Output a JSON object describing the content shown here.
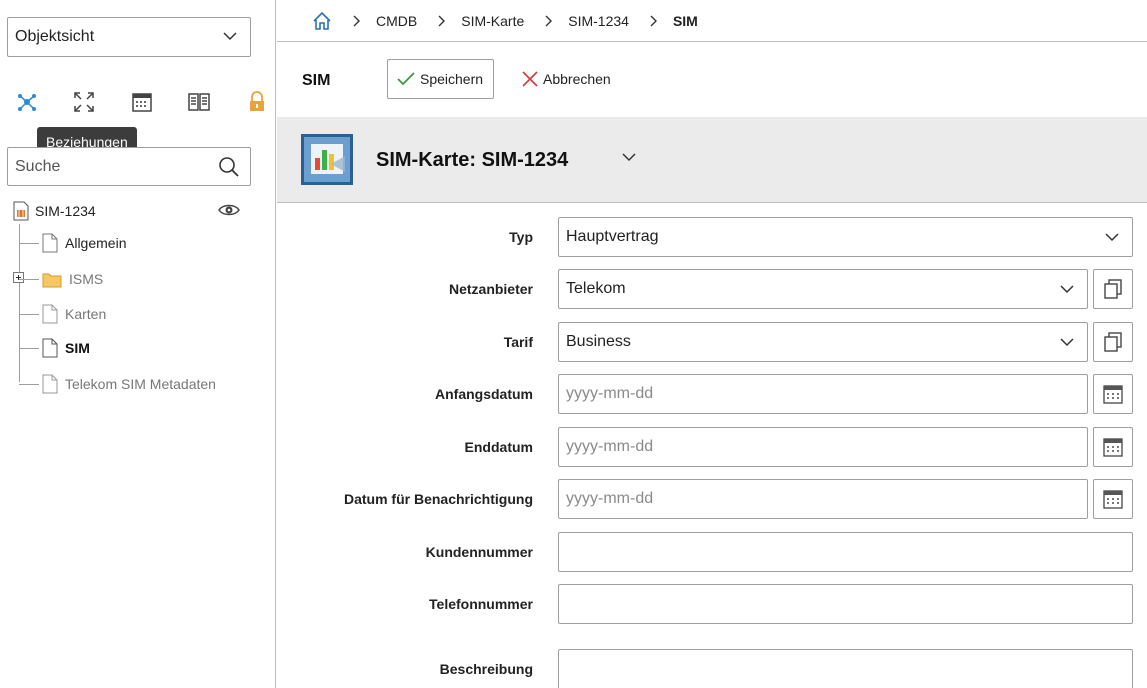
{
  "sidebar": {
    "view_select": "Objektsicht",
    "icons": [
      "relations-icon",
      "expand-icon",
      "calendar-icon",
      "book-icon",
      "lock-icon"
    ],
    "tooltip": "Beziehungen",
    "search_placeholder": "Suche",
    "tree": {
      "root": "SIM-1234",
      "items": [
        {
          "label": "Allgemein",
          "icon": "file-icon"
        },
        {
          "label": "ISMS",
          "icon": "folder-icon"
        },
        {
          "label": "Karten",
          "icon": "file-icon"
        },
        {
          "label": "SIM",
          "icon": "file-icon"
        },
        {
          "label": "Telekom SIM Metadaten",
          "icon": "file-icon"
        }
      ]
    }
  },
  "breadcrumb": {
    "items": [
      "CMDB",
      "SIM-Karte",
      "SIM-1234"
    ],
    "current": "SIM"
  },
  "toolbar": {
    "title": "SIM",
    "save_label": "Speichern",
    "cancel_label": "Abbrechen"
  },
  "object_header": {
    "title": "SIM-Karte: SIM-1234"
  },
  "form": {
    "typ": {
      "label": "Typ",
      "value": "Hauptvertrag"
    },
    "netzanbieter": {
      "label": "Netzanbieter",
      "value": "Telekom"
    },
    "tarif": {
      "label": "Tarif",
      "value": "Business"
    },
    "anfangsdatum": {
      "label": "Anfangsdatum",
      "placeholder": "yyyy-mm-dd"
    },
    "enddatum": {
      "label": "Enddatum",
      "placeholder": "yyyy-mm-dd"
    },
    "benachrichtigung": {
      "label": "Datum für Benachrichtigung",
      "placeholder": "yyyy-mm-dd"
    },
    "kundennummer": {
      "label": "Kundennummer",
      "value": ""
    },
    "telefonnummer": {
      "label": "Telefonnummer",
      "value": ""
    },
    "beschreibung": {
      "label": "Beschreibung",
      "value": ""
    }
  },
  "colors": {
    "accent_blue": "#2a8bd6",
    "save_check": "#3c9a3c",
    "cancel_x": "#d63a3a",
    "lock_orange": "#e8a33a",
    "sim_orange": "#e0762a",
    "header_bg": "#ebebeb"
  }
}
